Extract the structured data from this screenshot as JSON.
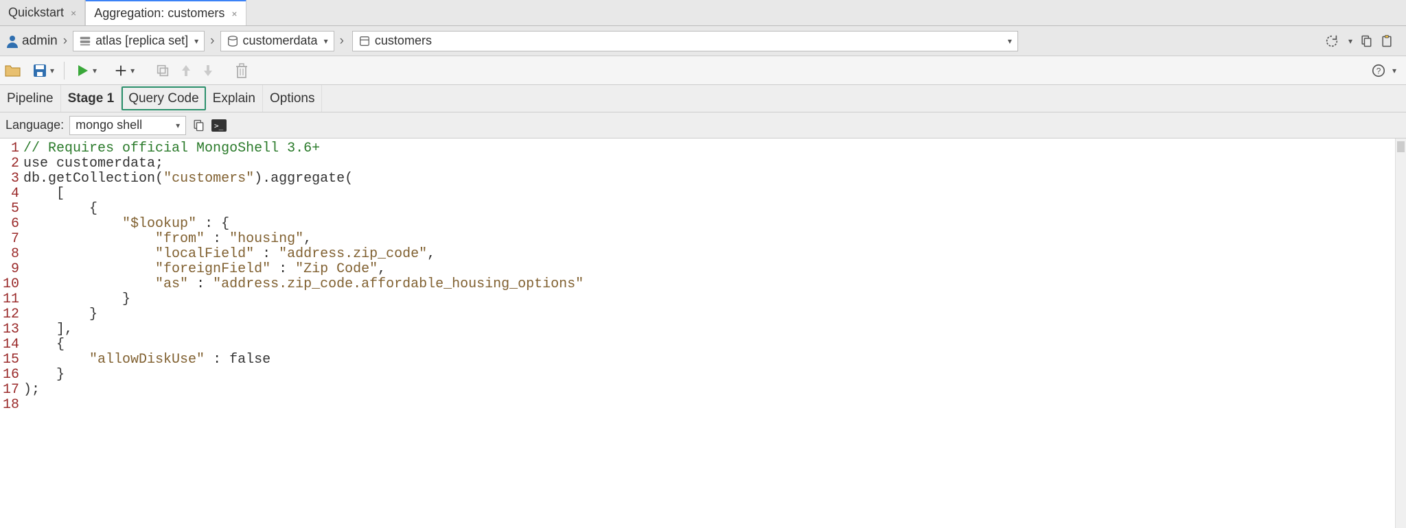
{
  "tabs": [
    {
      "label": "Quickstart"
    },
    {
      "label": "Aggregation: customers"
    }
  ],
  "breadcrumb": {
    "user": "admin",
    "cluster": "atlas [replica set]",
    "database": "customerdata",
    "collection": "customers"
  },
  "subtabs": {
    "pipeline": "Pipeline",
    "stage1": "Stage 1",
    "querycode": "Query Code",
    "explain": "Explain",
    "options": "Options"
  },
  "language": {
    "label": "Language:",
    "selected": "mongo shell"
  },
  "code": {
    "lines": [
      {
        "n": 1,
        "type": "comment",
        "text": "// Requires official MongoShell 3.6+"
      },
      {
        "n": 2,
        "type": "plain",
        "text": "use customerdata;"
      },
      {
        "n": 3,
        "type": "call",
        "prefix": "db.getCollection(",
        "str": "\"customers\"",
        "suffix": ").aggregate("
      },
      {
        "n": 4,
        "type": "plain",
        "text": "    ["
      },
      {
        "n": 5,
        "type": "plain",
        "text": "        {"
      },
      {
        "n": 6,
        "type": "kv",
        "indent": "            ",
        "key": "\"$lookup\"",
        "sep": " : ",
        "val": "{"
      },
      {
        "n": 7,
        "type": "kv",
        "indent": "                ",
        "key": "\"from\"",
        "sep": " : ",
        "val": "\"housing\"",
        "trail": ","
      },
      {
        "n": 8,
        "type": "kv",
        "indent": "                ",
        "key": "\"localField\"",
        "sep": " : ",
        "val": "\"address.zip_code\"",
        "trail": ","
      },
      {
        "n": 9,
        "type": "kv",
        "indent": "                ",
        "key": "\"foreignField\"",
        "sep": " : ",
        "val": "\"Zip Code\"",
        "trail": ","
      },
      {
        "n": 10,
        "type": "kv",
        "indent": "                ",
        "key": "\"as\"",
        "sep": " : ",
        "val": "\"address.zip_code.affordable_housing_options\""
      },
      {
        "n": 11,
        "type": "plain",
        "text": "            }"
      },
      {
        "n": 12,
        "type": "plain",
        "text": "        }"
      },
      {
        "n": 13,
        "type": "plain",
        "text": "    ],"
      },
      {
        "n": 14,
        "type": "plain",
        "text": "    {"
      },
      {
        "n": 15,
        "type": "kv",
        "indent": "        ",
        "key": "\"allowDiskUse\"",
        "sep": " : ",
        "val": "false",
        "valtype": "bool"
      },
      {
        "n": 16,
        "type": "plain",
        "text": "    }"
      },
      {
        "n": 17,
        "type": "plain",
        "text": ");"
      },
      {
        "n": 18,
        "type": "plain",
        "text": ""
      }
    ]
  }
}
